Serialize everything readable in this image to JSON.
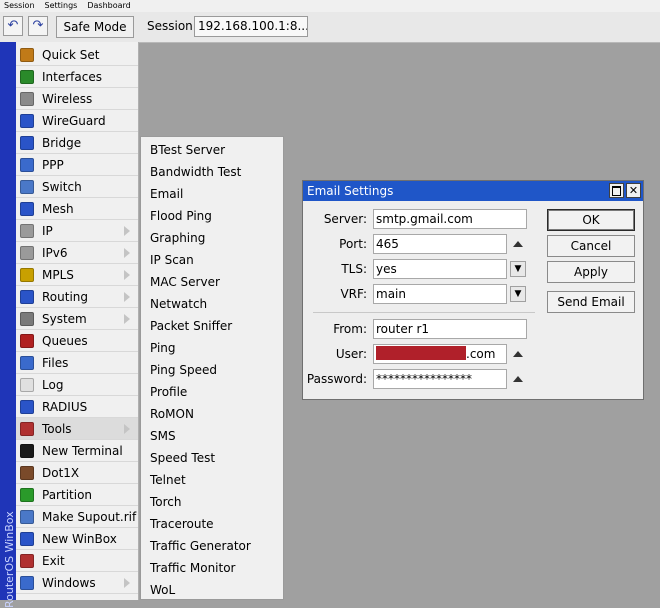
{
  "menubar": {
    "items": [
      "Session",
      "Settings",
      "Dashboard"
    ]
  },
  "toolbar": {
    "undo_icon": "undo-icon",
    "redo_icon": "redo-icon",
    "safe_mode_label": "Safe Mode",
    "session_label": "Session:",
    "session_value": "192.168.100.1:8..."
  },
  "brand": {
    "vertical_text": "RouterOS WinBox"
  },
  "sidebar": {
    "items": [
      {
        "label": "Quick Set",
        "icon": "quick-set-icon",
        "color": "#c07a18",
        "submenu": false
      },
      {
        "label": "Interfaces",
        "icon": "interfaces-icon",
        "color": "#2a8a2a",
        "submenu": false
      },
      {
        "label": "Wireless",
        "icon": "wireless-icon",
        "color": "#8a8a8a",
        "submenu": false
      },
      {
        "label": "WireGuard",
        "icon": "wireguard-icon",
        "color": "#2a54c8",
        "submenu": false
      },
      {
        "label": "Bridge",
        "icon": "bridge-icon",
        "color": "#2a54c8",
        "submenu": false
      },
      {
        "label": "PPP",
        "icon": "ppp-icon",
        "color": "#3a6acc",
        "submenu": false
      },
      {
        "label": "Switch",
        "icon": "switch-icon",
        "color": "#4a78c8",
        "submenu": false
      },
      {
        "label": "Mesh",
        "icon": "mesh-icon",
        "color": "#2a54c8",
        "submenu": false
      },
      {
        "label": "IP",
        "icon": "ip-icon",
        "color": "#9a9a9a",
        "submenu": true
      },
      {
        "label": "IPv6",
        "icon": "ipv6-icon",
        "color": "#9a9a9a",
        "submenu": true
      },
      {
        "label": "MPLS",
        "icon": "mpls-icon",
        "color": "#c8a000",
        "submenu": true
      },
      {
        "label": "Routing",
        "icon": "routing-icon",
        "color": "#2a54c8",
        "submenu": true
      },
      {
        "label": "System",
        "icon": "system-icon",
        "color": "#7a7a7a",
        "submenu": true
      },
      {
        "label": "Queues",
        "icon": "queues-icon",
        "color": "#b02020",
        "submenu": false
      },
      {
        "label": "Files",
        "icon": "files-icon",
        "color": "#3a6acc",
        "submenu": false
      },
      {
        "label": "Log",
        "icon": "log-icon",
        "color": "#e0e0e0",
        "submenu": false
      },
      {
        "label": "RADIUS",
        "icon": "radius-icon",
        "color": "#2a54c8",
        "submenu": false
      },
      {
        "label": "Tools",
        "icon": "tools-icon",
        "color": "#b03030",
        "submenu": true
      },
      {
        "label": "New Terminal",
        "icon": "terminal-icon",
        "color": "#1a1a1a",
        "submenu": false
      },
      {
        "label": "Dot1X",
        "icon": "dot1x-icon",
        "color": "#7a4a2a",
        "submenu": false
      },
      {
        "label": "Partition",
        "icon": "partition-icon",
        "color": "#2a9a2a",
        "submenu": false
      },
      {
        "label": "Make Supout.rif",
        "icon": "supout-icon",
        "color": "#4a78c8",
        "submenu": false
      },
      {
        "label": "New WinBox",
        "icon": "winbox-icon",
        "color": "#2a54c8",
        "submenu": false
      },
      {
        "label": "Exit",
        "icon": "exit-icon",
        "color": "#b03030",
        "submenu": false
      },
      {
        "label": "Windows",
        "icon": "windows-icon",
        "color": "#3a6acc",
        "submenu": true
      }
    ]
  },
  "tools_menu": {
    "items": [
      "BTest Server",
      "Bandwidth Test",
      "Email",
      "Flood Ping",
      "Graphing",
      "IP Scan",
      "MAC Server",
      "Netwatch",
      "Packet Sniffer",
      "Ping",
      "Ping Speed",
      "Profile",
      "RoMON",
      "SMS",
      "Speed Test",
      "Telnet",
      "Torch",
      "Traceroute",
      "Traffic Generator",
      "Traffic Monitor",
      "WoL"
    ]
  },
  "dialog": {
    "title": "Email Settings",
    "server_label": "Server:",
    "server_value": "smtp.gmail.com",
    "port_label": "Port:",
    "port_value": "465",
    "tls_label": "TLS:",
    "tls_value": "yes",
    "vrf_label": "VRF:",
    "vrf_value": "main",
    "from_label": "From:",
    "from_value": "router r1",
    "user_label": "User:",
    "user_suffix": ".com",
    "password_label": "Password:",
    "password_value": "****************",
    "ok_label": "OK",
    "cancel_label": "Cancel",
    "apply_label": "Apply",
    "send_email_label": "Send Email"
  },
  "colors": {
    "accent_bar": "#1f35b8",
    "title_bar": "#1f56c8",
    "redaction": "#b0202a"
  }
}
